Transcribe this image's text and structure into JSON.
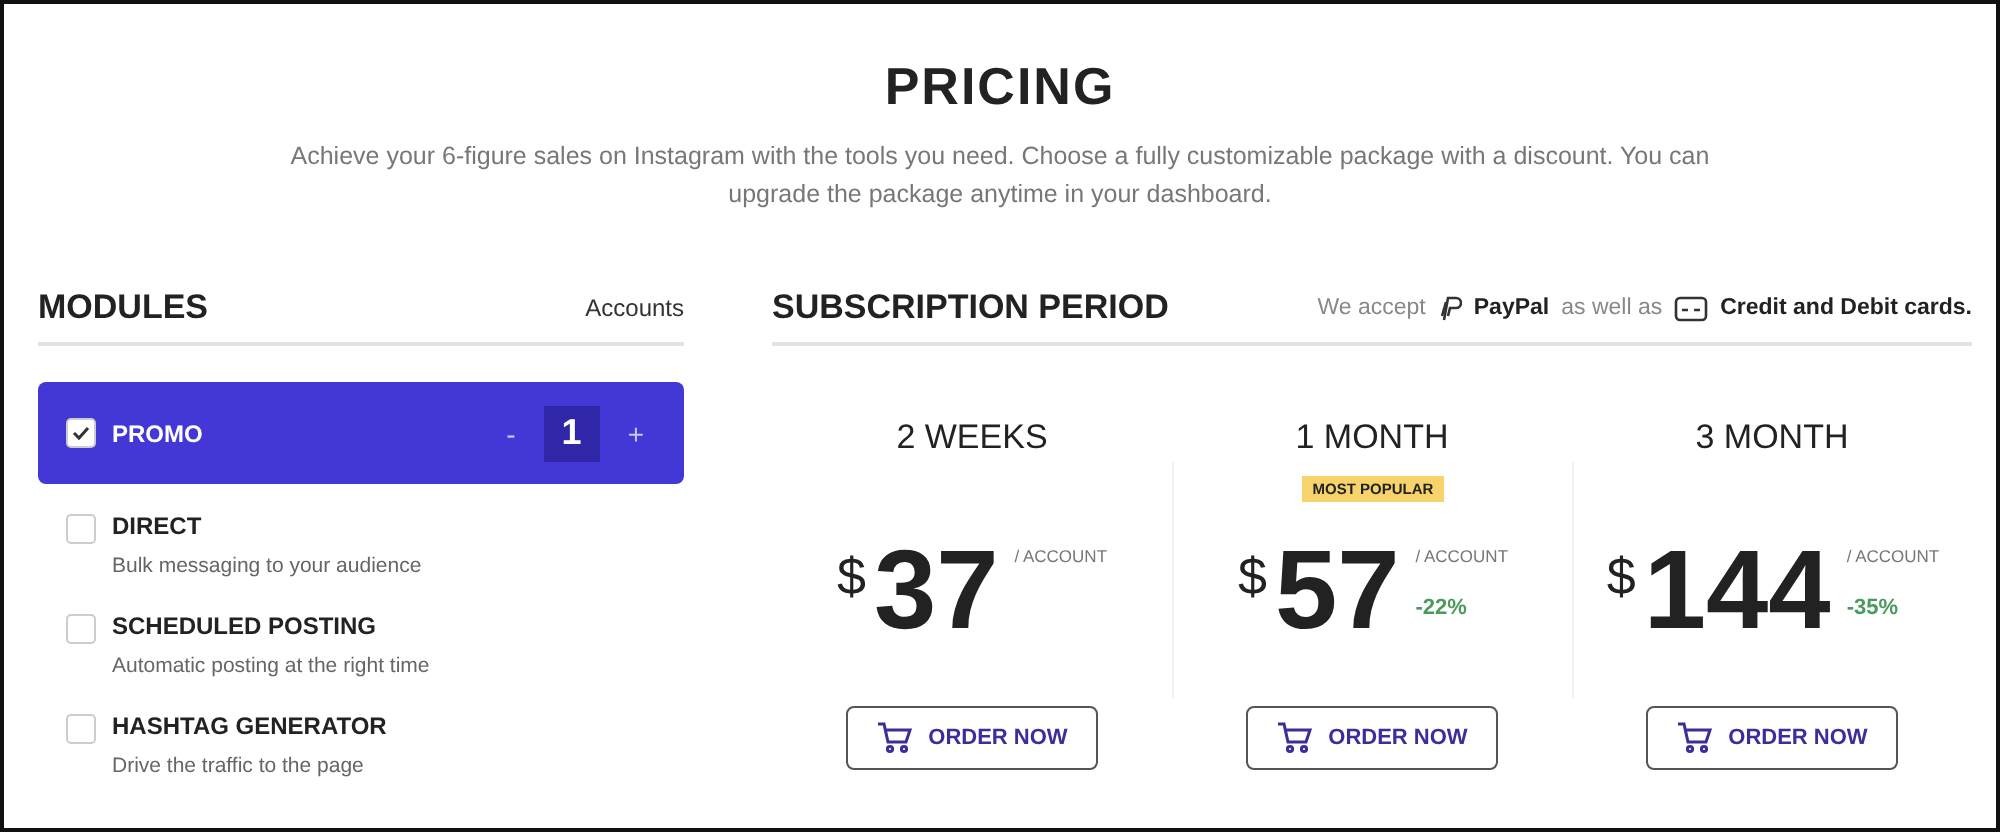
{
  "title": "PRICING",
  "subtitle": "Achieve your 6-figure sales on Instagram with the tools you need. Choose a fully customizable package with a discount. You can upgrade the package anytime in your dashboard.",
  "modules": {
    "heading": "MODULES",
    "accounts_label": "Accounts",
    "items": [
      {
        "name": "PROMO",
        "checked": true,
        "selected": true,
        "counter": {
          "minus": "-",
          "value": "1",
          "plus": "+"
        }
      },
      {
        "name": "DIRECT",
        "checked": false,
        "selected": false,
        "description": "Bulk messaging to your audience"
      },
      {
        "name": "SCHEDULED POSTING",
        "checked": false,
        "selected": false,
        "description": "Automatic posting at the right time"
      },
      {
        "name": "HASHTAG GENERATOR",
        "checked": false,
        "selected": false,
        "description": "Drive the traffic to the page"
      }
    ]
  },
  "subscription": {
    "heading": "SUBSCRIPTION PERIOD",
    "accept_text": "We accept",
    "paypal": "PayPal",
    "as_well_as": "as well as",
    "cards": "Credit and Debit cards.",
    "plans": [
      {
        "period": "2 WEEKS",
        "currency": "$",
        "price": "37",
        "unit": "/ ACCOUNT",
        "button": "ORDER NOW"
      },
      {
        "period": "1 MONTH",
        "badge": "MOST POPULAR",
        "currency": "$",
        "price": "57",
        "unit": "/ ACCOUNT",
        "discount": "-22%",
        "button": "ORDER NOW"
      },
      {
        "period": "3 MONTH",
        "currency": "$",
        "price": "144",
        "unit": "/ ACCOUNT",
        "discount": "-35%",
        "button": "ORDER NOW"
      }
    ]
  }
}
